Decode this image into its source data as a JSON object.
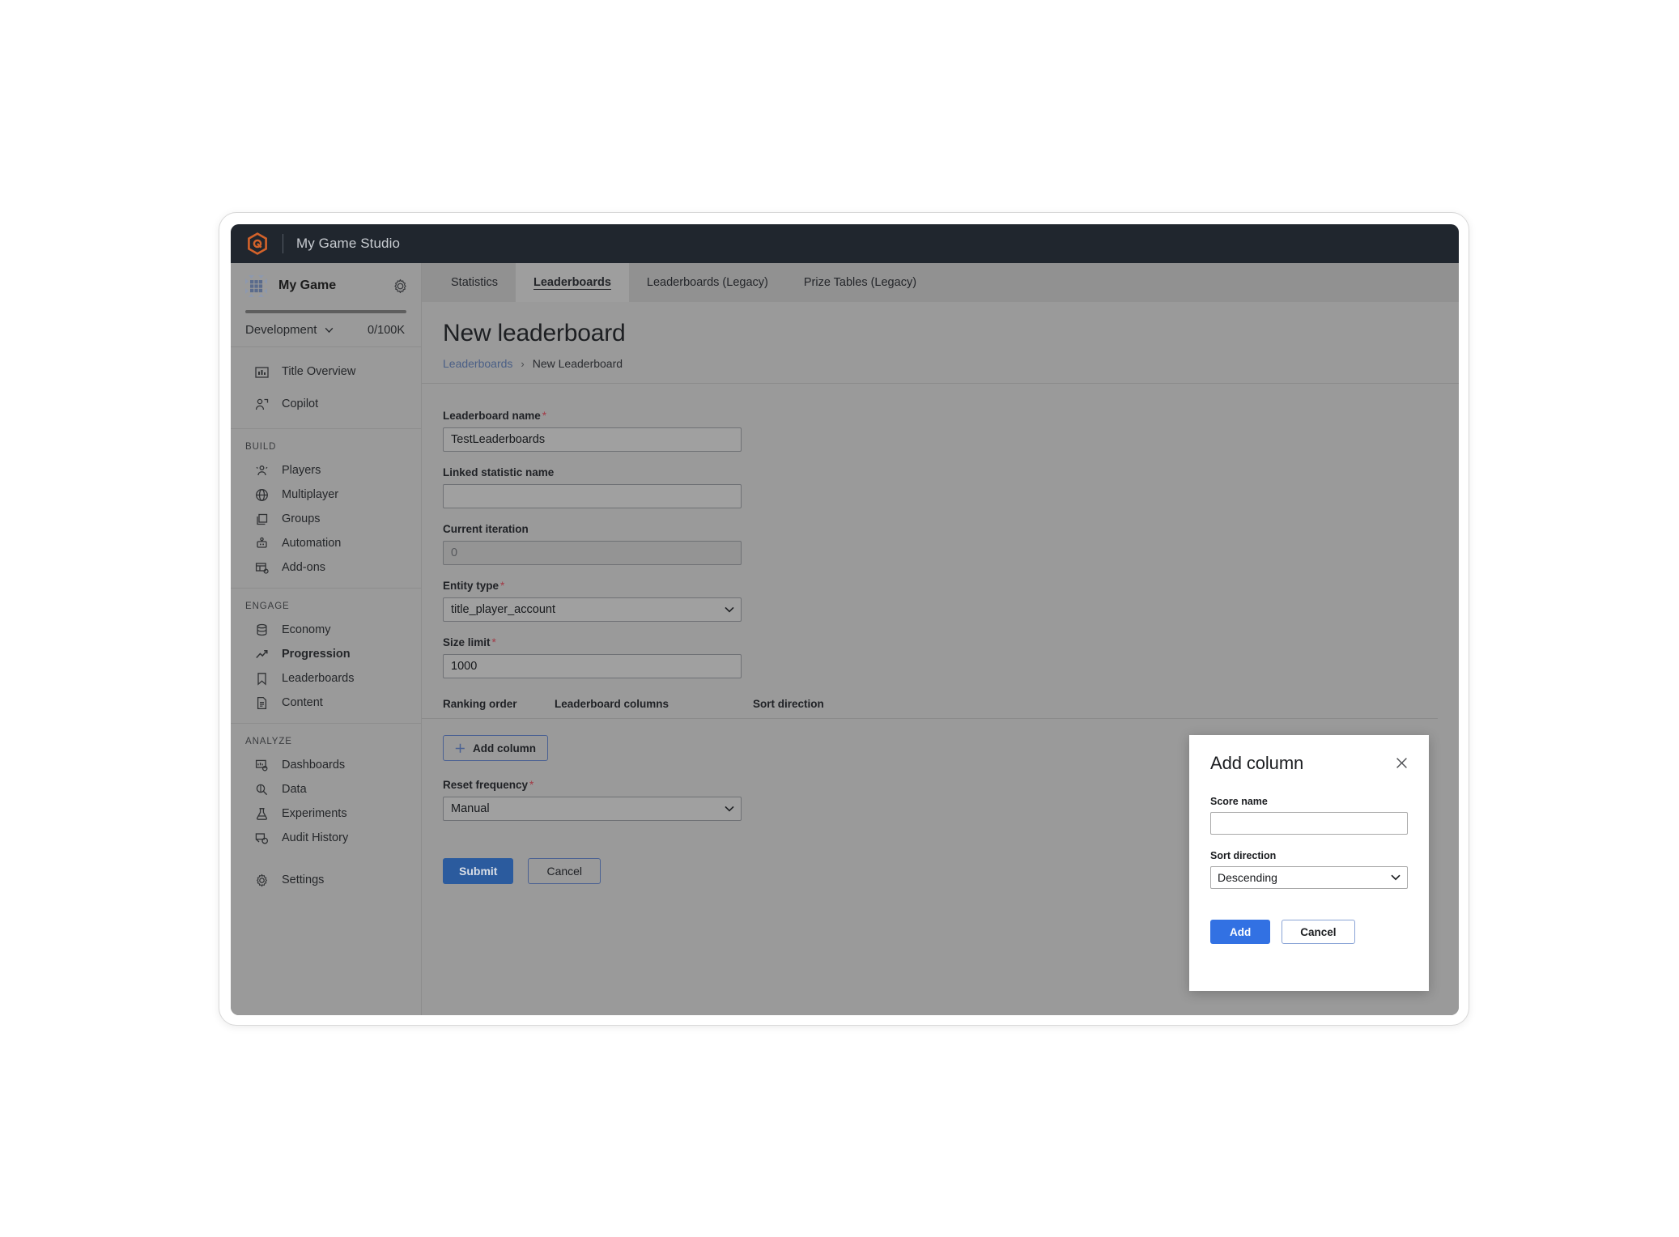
{
  "topbar": {
    "studio_name": "My Game Studio",
    "logo_icon": "hexagon-logo-icon"
  },
  "sidebar": {
    "game_title": "My Game",
    "game_icon": "game-grid-icon",
    "settings_icon": "gear-icon",
    "environment": {
      "name": "Development",
      "caret_icon": "chevron-down-icon",
      "quota": "0/100K"
    },
    "top_items": [
      {
        "label": "Title Overview",
        "icon": "bar-chart-icon"
      },
      {
        "label": "Copilot",
        "icon": "copilot-person-icon"
      }
    ],
    "sections": [
      {
        "label": "BUILD",
        "items": [
          {
            "label": "Players",
            "icon": "players-icon"
          },
          {
            "label": "Multiplayer",
            "icon": "globe-icon"
          },
          {
            "label": "Groups",
            "icon": "groups-stack-icon"
          },
          {
            "label": "Automation",
            "icon": "robot-icon"
          },
          {
            "label": "Add-ons",
            "icon": "addons-icon"
          }
        ]
      },
      {
        "label": "ENGAGE",
        "items": [
          {
            "label": "Economy",
            "icon": "database-icon"
          },
          {
            "label": "Progression",
            "icon": "trending-up-icon",
            "active": true
          },
          {
            "label": "Leaderboards",
            "icon": "bookmark-icon"
          },
          {
            "label": "Content",
            "icon": "document-icon"
          }
        ]
      },
      {
        "label": "ANALYZE",
        "items": [
          {
            "label": "Dashboards",
            "icon": "dashboards-icon"
          },
          {
            "label": "Data",
            "icon": "data-magnifier-icon"
          },
          {
            "label": "Experiments",
            "icon": "flask-icon"
          },
          {
            "label": "Audit History",
            "icon": "audit-shield-icon"
          }
        ]
      }
    ],
    "settings_item": {
      "label": "Settings",
      "icon": "gear-icon"
    }
  },
  "tabs": [
    {
      "label": "Statistics",
      "active": false
    },
    {
      "label": "Leaderboards",
      "active": true
    },
    {
      "label": "Leaderboards (Legacy)",
      "active": false
    },
    {
      "label": "Prize Tables (Legacy)",
      "active": false
    }
  ],
  "page": {
    "title": "New leaderboard",
    "breadcrumb": {
      "parent": "Leaderboards",
      "separator": "›",
      "current": "New Leaderboard"
    }
  },
  "form": {
    "leaderboard_name": {
      "label": "Leaderboard name",
      "required": "*",
      "value": "TestLeaderboards",
      "placeholder": ""
    },
    "linked_statistic_name": {
      "label": "Linked statistic name",
      "required": "",
      "value": "",
      "placeholder": ""
    },
    "current_iteration": {
      "label": "Current iteration",
      "required": "",
      "value": "0",
      "placeholder": ""
    },
    "entity_type": {
      "label": "Entity type",
      "required": "*",
      "value": "title_player_account",
      "caret_icon": "chevron-down-icon"
    },
    "size_limit": {
      "label": "Size limit",
      "required": "*",
      "value": "1000",
      "placeholder": ""
    },
    "table_headers": {
      "ranking_order": "Ranking order",
      "leaderboard_columns": "Leaderboard columns",
      "sort_direction": "Sort direction"
    },
    "add_column_button": {
      "label": "Add column",
      "icon": "plus-icon"
    },
    "reset_frequency": {
      "label": "Reset frequency",
      "required": "*",
      "value": "Manual",
      "caret_icon": "chevron-down-icon"
    },
    "submit_button": "Submit",
    "cancel_button": "Cancel"
  },
  "modal": {
    "title": "Add column",
    "close_icon": "close-icon",
    "score_name": {
      "label": "Score name",
      "value": "",
      "placeholder": ""
    },
    "sort_direction": {
      "label": "Sort direction",
      "value": "Descending",
      "caret_icon": "chevron-down-icon"
    },
    "add_button": "Add",
    "cancel_button": "Cancel"
  },
  "colors": {
    "topbar_bg": "#20262e",
    "brand_orange": "#d3622a",
    "accent_blue": "#3271e3",
    "submit_blue": "#2b5b9e",
    "link_blue": "#4a5f86",
    "required_red": "#a33a46",
    "overlay_gray": "#9a9a9a"
  }
}
